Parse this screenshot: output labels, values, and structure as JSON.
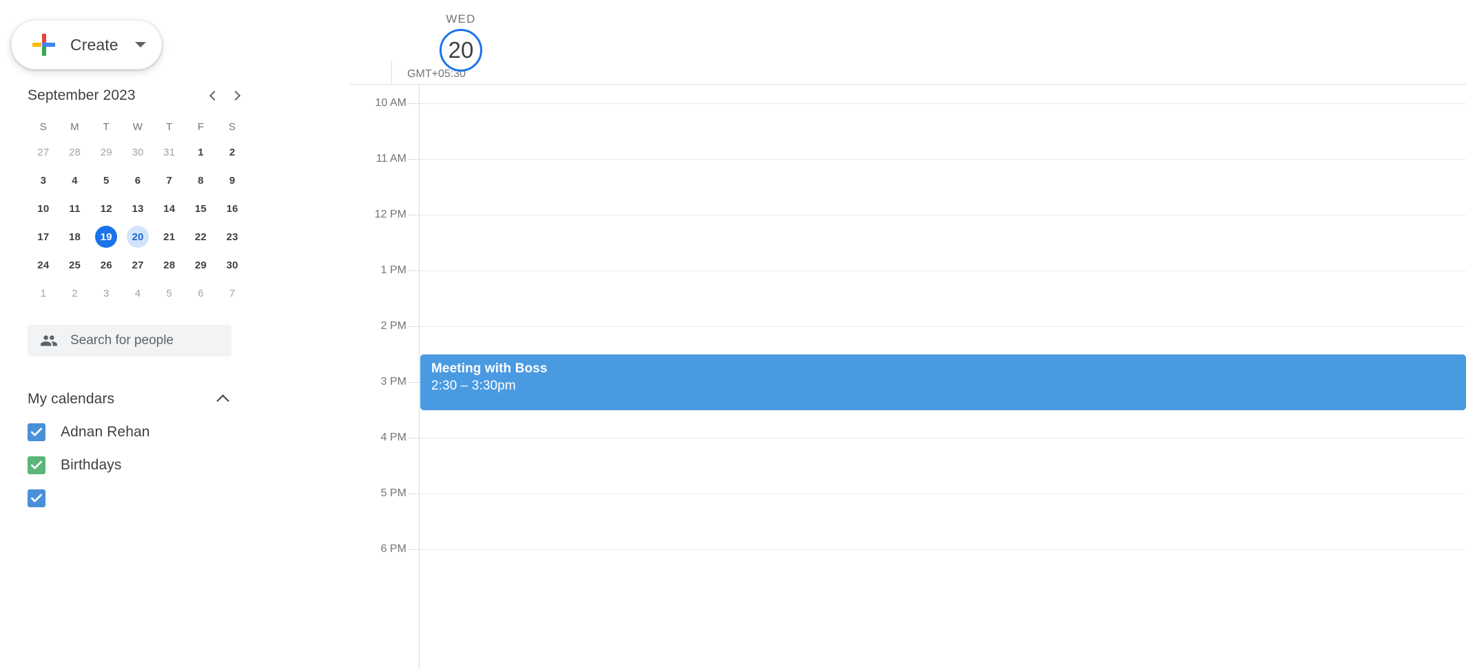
{
  "create": {
    "label": "Create",
    "plus_icon": "plus-icon",
    "caret_icon": "chevron-down-icon"
  },
  "mini_calendar": {
    "title": "September 2023",
    "prev_icon": "chevron-left-icon",
    "next_icon": "chevron-right-icon",
    "day_initials": [
      "S",
      "M",
      "T",
      "W",
      "T",
      "F",
      "S"
    ],
    "weeks": [
      [
        {
          "d": "27",
          "state": "muted"
        },
        {
          "d": "28",
          "state": "muted"
        },
        {
          "d": "29",
          "state": "muted"
        },
        {
          "d": "30",
          "state": "muted"
        },
        {
          "d": "31",
          "state": "muted"
        },
        {
          "d": "1",
          "state": "normal"
        },
        {
          "d": "2",
          "state": "normal"
        }
      ],
      [
        {
          "d": "3",
          "state": "normal"
        },
        {
          "d": "4",
          "state": "normal"
        },
        {
          "d": "5",
          "state": "normal"
        },
        {
          "d": "6",
          "state": "normal"
        },
        {
          "d": "7",
          "state": "normal"
        },
        {
          "d": "8",
          "state": "normal"
        },
        {
          "d": "9",
          "state": "normal"
        }
      ],
      [
        {
          "d": "10",
          "state": "normal"
        },
        {
          "d": "11",
          "state": "normal"
        },
        {
          "d": "12",
          "state": "normal"
        },
        {
          "d": "13",
          "state": "normal"
        },
        {
          "d": "14",
          "state": "normal"
        },
        {
          "d": "15",
          "state": "normal"
        },
        {
          "d": "16",
          "state": "normal"
        }
      ],
      [
        {
          "d": "17",
          "state": "normal"
        },
        {
          "d": "18",
          "state": "normal"
        },
        {
          "d": "19",
          "state": "today"
        },
        {
          "d": "20",
          "state": "selected"
        },
        {
          "d": "21",
          "state": "normal"
        },
        {
          "d": "22",
          "state": "normal"
        },
        {
          "d": "23",
          "state": "normal"
        }
      ],
      [
        {
          "d": "24",
          "state": "normal"
        },
        {
          "d": "25",
          "state": "normal"
        },
        {
          "d": "26",
          "state": "normal"
        },
        {
          "d": "27",
          "state": "normal"
        },
        {
          "d": "28",
          "state": "normal"
        },
        {
          "d": "29",
          "state": "normal"
        },
        {
          "d": "30",
          "state": "normal"
        }
      ],
      [
        {
          "d": "1",
          "state": "muted"
        },
        {
          "d": "2",
          "state": "muted"
        },
        {
          "d": "3",
          "state": "muted"
        },
        {
          "d": "4",
          "state": "muted"
        },
        {
          "d": "5",
          "state": "muted"
        },
        {
          "d": "6",
          "state": "muted"
        },
        {
          "d": "7",
          "state": "muted"
        }
      ]
    ],
    "today_color": "#1a73e8",
    "selected_bg": "#d2e3fc",
    "selected_text": "#1967d2"
  },
  "people_search": {
    "placeholder": "Search for people",
    "icon": "people-icon"
  },
  "my_calendars": {
    "title": "My calendars",
    "collapse_icon": "chevron-up-icon",
    "items": [
      {
        "label": "Adnan Rehan",
        "color": "#4a90d9",
        "checked": true
      },
      {
        "label": "Birthdays",
        "color": "#5ab679",
        "checked": true
      },
      {
        "label": "",
        "color": "#4a90d9",
        "checked": true
      }
    ]
  },
  "day_view": {
    "timezone": "GMT+05:30",
    "day_of_week": "WED",
    "day_number": "20",
    "date_ring_color": "#1a73e8",
    "time_labels": [
      "10 AM",
      "11 AM",
      "12 PM",
      "1 PM",
      "2 PM",
      "3 PM",
      "4 PM",
      "5 PM",
      "6 PM"
    ],
    "events": [
      {
        "title": "Meeting with Boss",
        "time": "2:30 – 3:30pm",
        "color": "#4a9ae1",
        "start_hour_index": 4.5,
        "duration_hours": 1
      }
    ]
  }
}
